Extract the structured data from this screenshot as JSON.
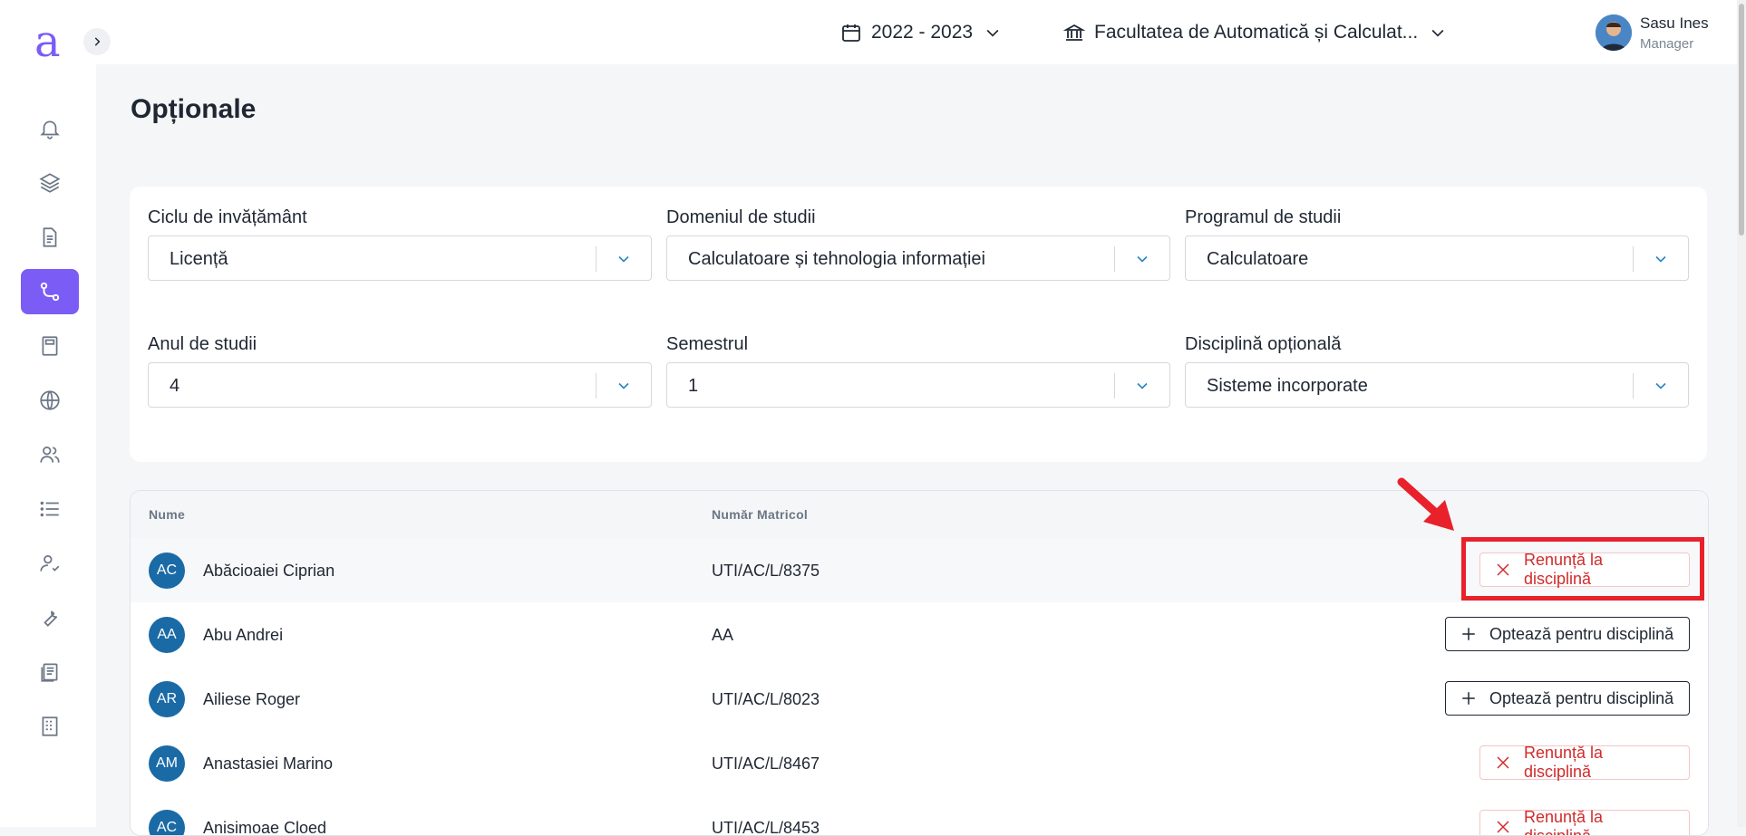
{
  "logo": {
    "text": "a"
  },
  "topbar": {
    "year": "2022 - 2023",
    "faculty": "Facultatea de Automatică și Calculat...",
    "user": {
      "name": "Sasu Ines",
      "role": "Manager"
    }
  },
  "page": {
    "title": "Opționale"
  },
  "filters": {
    "ciclu": {
      "label": "Ciclu de invățământ",
      "value": "Licență"
    },
    "domeniu": {
      "label": "Domeniul de studii",
      "value": "Calculatoare și tehnologia informației"
    },
    "program": {
      "label": "Programul de studii",
      "value": "Calculatoare"
    },
    "an": {
      "label": "Anul de studii",
      "value": "4"
    },
    "semestru": {
      "label": "Semestrul",
      "value": "1"
    },
    "disciplina": {
      "label": "Disciplină opțională",
      "value": "Sisteme incorporate"
    }
  },
  "table": {
    "columns": {
      "name": "Nume",
      "matricol": "Număr Matricol"
    },
    "rows": [
      {
        "initials": "AC",
        "name": "Abăcioaiei Ciprian",
        "matricol": "UTI/AC/L/8375",
        "action": "Renunță la disciplină"
      },
      {
        "initials": "AA",
        "name": "Abu Andrei",
        "matricol": "AA",
        "action": "Optează pentru disciplină"
      },
      {
        "initials": "AR",
        "name": "Ailiese Roger",
        "matricol": "UTI/AC/L/8023",
        "action": "Optează pentru disciplină"
      },
      {
        "initials": "AM",
        "name": "Anastasiei Marino",
        "matricol": "UTI/AC/L/8467",
        "action": "Renunță la disciplină"
      },
      {
        "initials": "AC",
        "name": "Anisimoae Cloed",
        "matricol": "UTI/AC/L/8453",
        "action": "Renunță la disciplină"
      }
    ]
  },
  "colors": {
    "accent": "#7b5cf5",
    "danger": "#d12b2b",
    "avatar": "#1a6aa6",
    "highlight": "#e8212b"
  }
}
